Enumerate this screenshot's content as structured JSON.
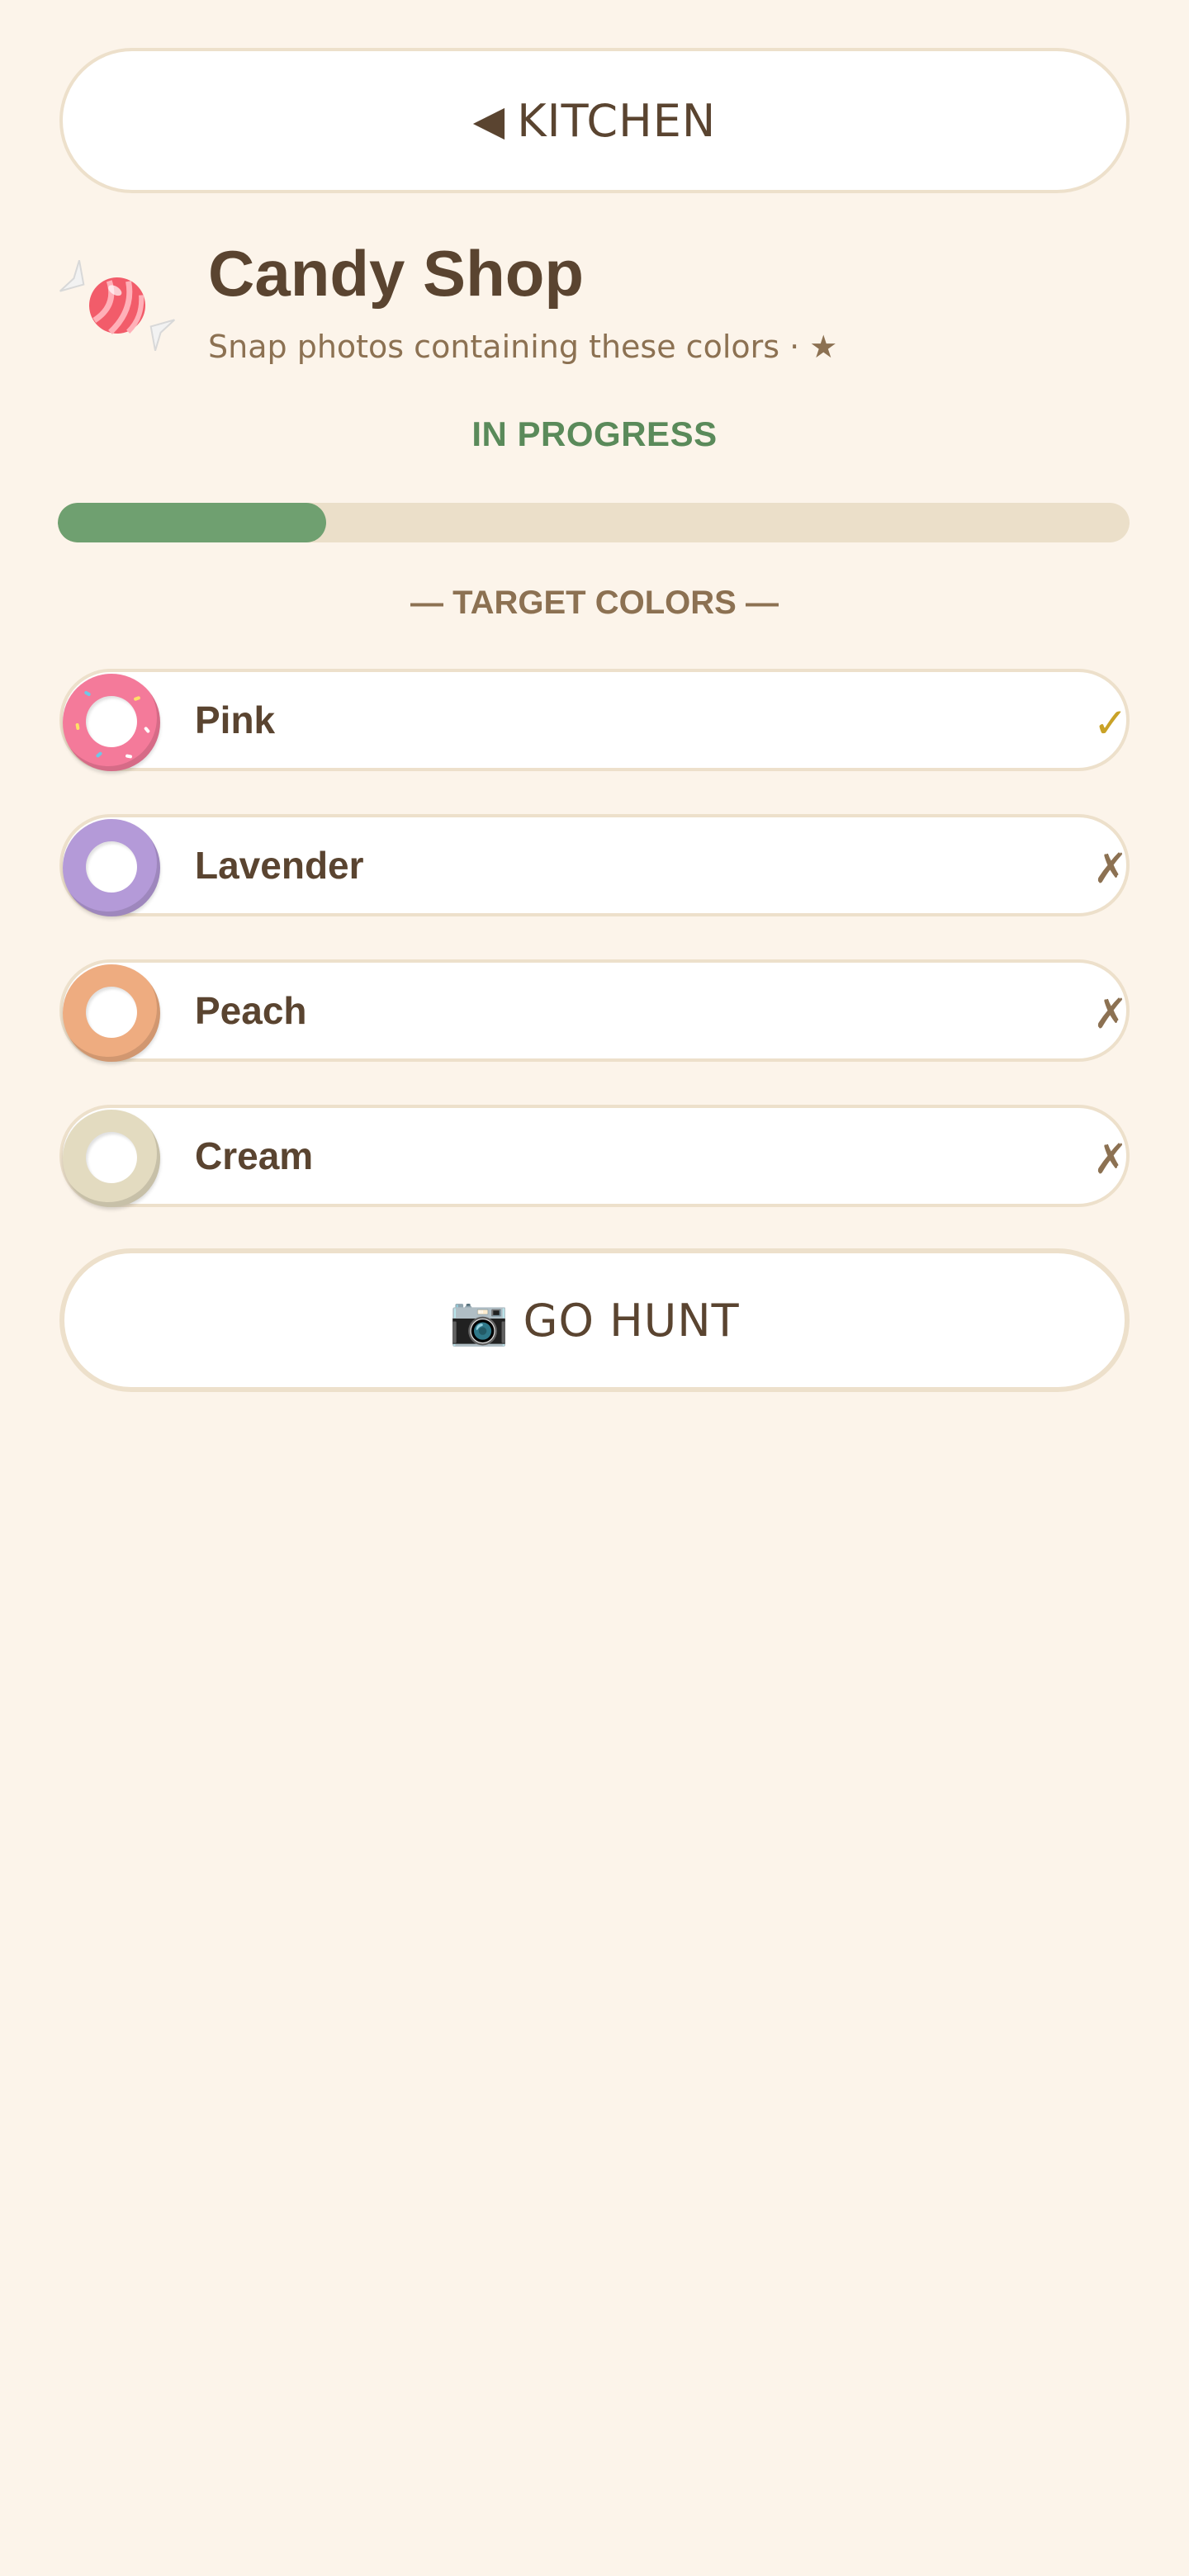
{
  "nav": {
    "back_arrow": "◀",
    "back_label": "KITCHEN"
  },
  "level": {
    "icon": "candy-icon",
    "title": "Candy Shop",
    "subtitle": "Snap photos containing these colors · ★",
    "status": "IN PROGRESS",
    "status_color": "#5a8a5a",
    "progress": 0.25
  },
  "targets": {
    "section_label": "— TARGET COLORS —",
    "items": [
      {
        "label": "Pink",
        "swatch": "#f47a9a",
        "found": true,
        "mark": "✓"
      },
      {
        "label": "Lavender",
        "swatch": "#b49ad8",
        "found": false,
        "mark": "✗"
      },
      {
        "label": "Peach",
        "swatch": "#eeac80",
        "found": false,
        "mark": "✗"
      },
      {
        "label": "Cream",
        "swatch": "#e3dbc0",
        "found": false,
        "mark": "✗"
      }
    ]
  },
  "action": {
    "camera_icon": "📷",
    "label": "GO HUNT"
  },
  "colors": {
    "background": "#fcf4ea",
    "text": "#5a4430",
    "muted": "#8c7152",
    "progress_fill": "#6fa070",
    "progress_track": "#ebdfc9",
    "check": "#c9a227"
  }
}
